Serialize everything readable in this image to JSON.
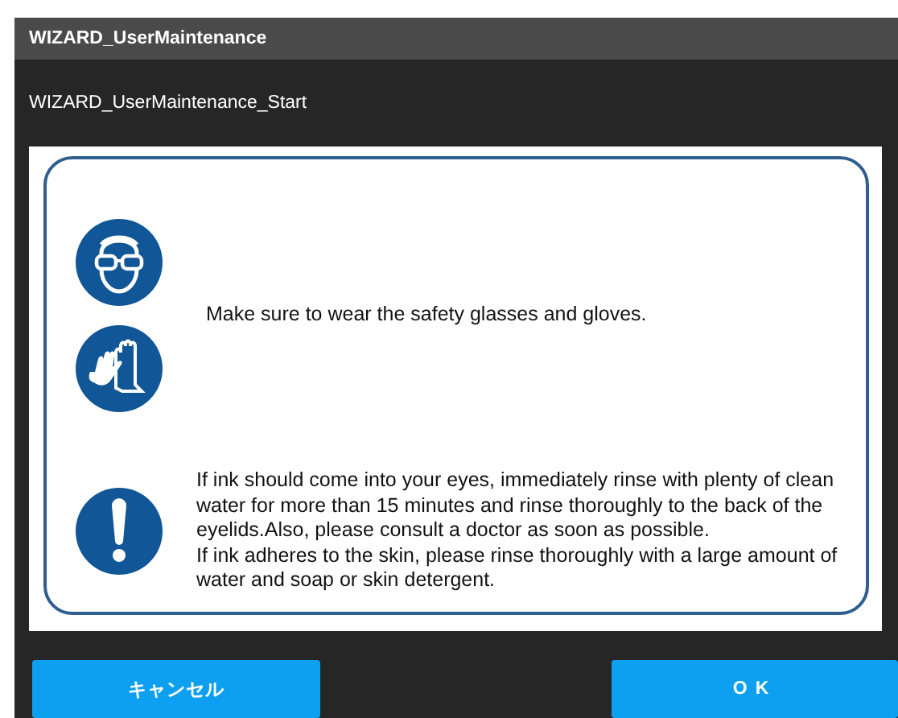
{
  "window": {
    "title": "WIZARD_UserMaintenance"
  },
  "step_title": "WIZARD_UserMaintenance_Start",
  "notices": [
    {
      "kind": "protective-gear",
      "paragraphs": [
        "Make sure to wear the safety glasses and gloves."
      ]
    },
    {
      "kind": "warning",
      "paragraphs": [
        "If ink should come into your eyes, immediately rinse with plenty of clean water for more than 15 minutes and rinse thoroughly to the back of the eyelids.Also, please consult a doctor as soon as possible.",
        "If ink adheres to the skin, please rinse thoroughly with a large amount of water and soap or skin detergent."
      ]
    }
  ],
  "buttons": [
    {
      "label": "キャンセル"
    },
    {
      "label": "OK"
    }
  ]
}
